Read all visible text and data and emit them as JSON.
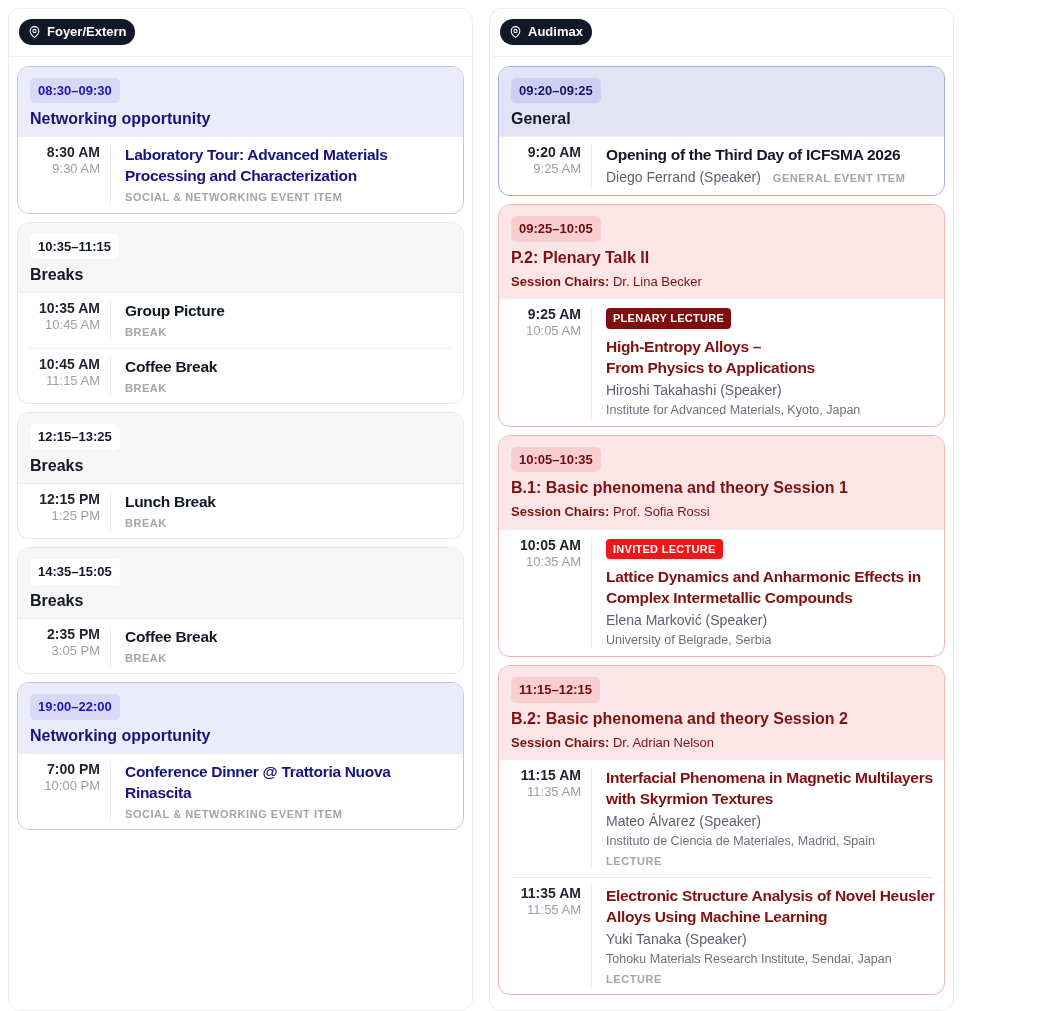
{
  "columns": [
    {
      "location": "Foyer/Extern",
      "sessions": [
        {
          "kind": "social",
          "time": "08:30–09:30",
          "title": "Networking opportunity",
          "items": [
            {
              "start": "8:30 AM",
              "end": "9:30 AM",
              "title": "Laboratory Tour: Advanced Materials Processing and Characterization",
              "type_label": "SOCIAL & NETWORKING EVENT ITEM"
            }
          ]
        },
        {
          "kind": "break",
          "time": "10:35–11:15",
          "title": "Breaks",
          "items": [
            {
              "start": "10:35 AM",
              "end": "10:45 AM",
              "title": "Group Picture",
              "type_label": "BREAK"
            },
            {
              "start": "10:45 AM",
              "end": "11:15 AM",
              "title": "Coffee Break",
              "type_label": "BREAK"
            }
          ]
        },
        {
          "kind": "break",
          "time": "12:15–13:25",
          "title": "Breaks",
          "items": [
            {
              "start": "12:15 PM",
              "end": "1:25 PM",
              "title": "Lunch Break",
              "type_label": "BREAK"
            }
          ]
        },
        {
          "kind": "break",
          "time": "14:35–15:05",
          "title": "Breaks",
          "items": [
            {
              "start": "2:35 PM",
              "end": "3:05 PM",
              "title": "Coffee Break",
              "type_label": "BREAK"
            }
          ]
        },
        {
          "kind": "social",
          "time": "19:00–22:00",
          "title": "Networking opportunity",
          "items": [
            {
              "start": "7:00 PM",
              "end": "10:00 PM",
              "title": "Conference Dinner @ Trattoria Nuova Rinascita",
              "type_label": "SOCIAL & NETWORKING EVENT ITEM"
            }
          ]
        }
      ]
    },
    {
      "location": "Audimax",
      "sessions": [
        {
          "kind": "general",
          "time": "09:20–09:25",
          "title": "General",
          "items": [
            {
              "start": "9:20 AM",
              "end": "9:25 AM",
              "title": "Opening of the Third Day of ICFSMA 2026",
              "speaker": "Diego Ferrand (Speaker)",
              "type_label": "GENERAL EVENT ITEM"
            }
          ]
        },
        {
          "kind": "scientific",
          "time": "09:25–10:05",
          "title": "P.2: Plenary Talk II",
          "chairs_label": "Session Chairs:",
          "chairs": "Dr. Lina Becker",
          "items": [
            {
              "start": "9:25 AM",
              "end": "10:05 AM",
              "badge": {
                "kind": "plenary",
                "label": "PLENARY LECTURE"
              },
              "title": "High-Entropy Alloys –\nFrom Physics to Applications",
              "speaker": "Hiroshi Takahashi (Speaker)",
              "affiliation": "Institute for Advanced Materials, Kyoto, Japan"
            }
          ]
        },
        {
          "kind": "scientific",
          "time": "10:05–10:35",
          "title": "B.1: Basic phenomena and theory Session 1",
          "chairs_label": "Session Chairs:",
          "chairs": "Prof. Sofia Rossi",
          "items": [
            {
              "start": "10:05 AM",
              "end": "10:35 AM",
              "badge": {
                "kind": "invited",
                "label": "INVITED LECTURE"
              },
              "title": "Lattice Dynamics and Anharmonic Effects in Complex Intermetallic Compounds",
              "speaker": "Elena Marković (Speaker)",
              "affiliation": "University of Belgrade, Serbia"
            }
          ]
        },
        {
          "kind": "scientific",
          "time": "11:15–12:15",
          "title": "B.2: Basic phenomena and theory Session 2",
          "chairs_label": "Session Chairs:",
          "chairs": "Dr. Adrian Nelson",
          "items": [
            {
              "start": "11:15 AM",
              "end": "11:35 AM",
              "title": "Interfacial Phenomena in Magnetic Multilayers with Skyrmion Textures",
              "speaker": "Mateo Álvarez (Speaker)",
              "affiliation": "Instituto de Ciencia de Materiales, Madrid, Spain",
              "type_label": "LECTURE"
            },
            {
              "start": "11:35 AM",
              "end": "11:55 AM",
              "title": "Electronic Structure Analysis of Novel Heusler Alloys Using Machine Learning",
              "speaker": "Yuki Tanaka (Speaker)",
              "affiliation": "Tohoku Materials Research Institute, Sendai, Japan",
              "type_label": "LECTURE"
            }
          ]
        }
      ]
    }
  ]
}
